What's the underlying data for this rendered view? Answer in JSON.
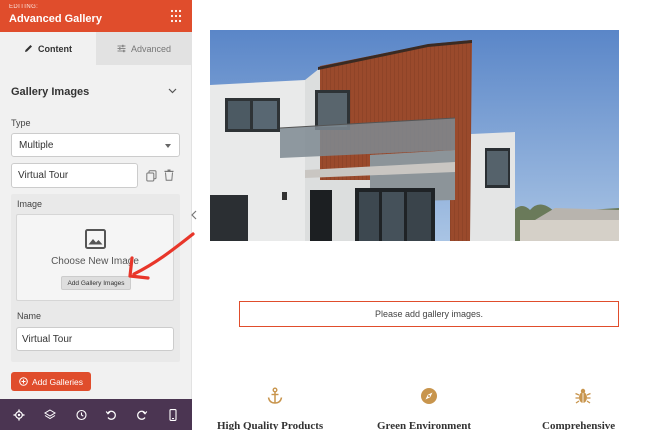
{
  "sidebar": {
    "header": {
      "editing_label": "EDITING:",
      "title": "Advanced Gallery"
    },
    "tabs": [
      {
        "label": "Content",
        "active": true,
        "icon": "pencil-icon"
      },
      {
        "label": "Advanced",
        "active": false,
        "icon": "sliders-icon"
      }
    ],
    "section_title": "Gallery Images",
    "type_field": {
      "label": "Type",
      "value": "Multiple"
    },
    "gallery_item": {
      "name_value": "Virtual Tour",
      "image_label": "Image",
      "choose_image_text": "Choose New Image",
      "add_images_button": "Add Gallery Images",
      "name_label": "Name",
      "name_input_value": "Virtual Tour"
    },
    "add_galleries_button": "Add Galleries",
    "bottom_bar_icons": [
      "gear-icon",
      "layers-icon",
      "history-icon",
      "undo-icon",
      "redo-icon",
      "mobile-icon"
    ]
  },
  "preview": {
    "notice_text": "Please add gallery images.",
    "features": [
      {
        "icon": "anchor-icon",
        "title": "High Quality Products"
      },
      {
        "icon": "compass-icon",
        "title": "Green Environment"
      },
      {
        "icon": "bug-icon",
        "title": "Comprehensive"
      }
    ]
  },
  "colors": {
    "brand": "#e04d2c",
    "bottom_bar": "#4b3552",
    "feature_icon": "#c8954d",
    "annotation_arrow": "#e8362a"
  }
}
